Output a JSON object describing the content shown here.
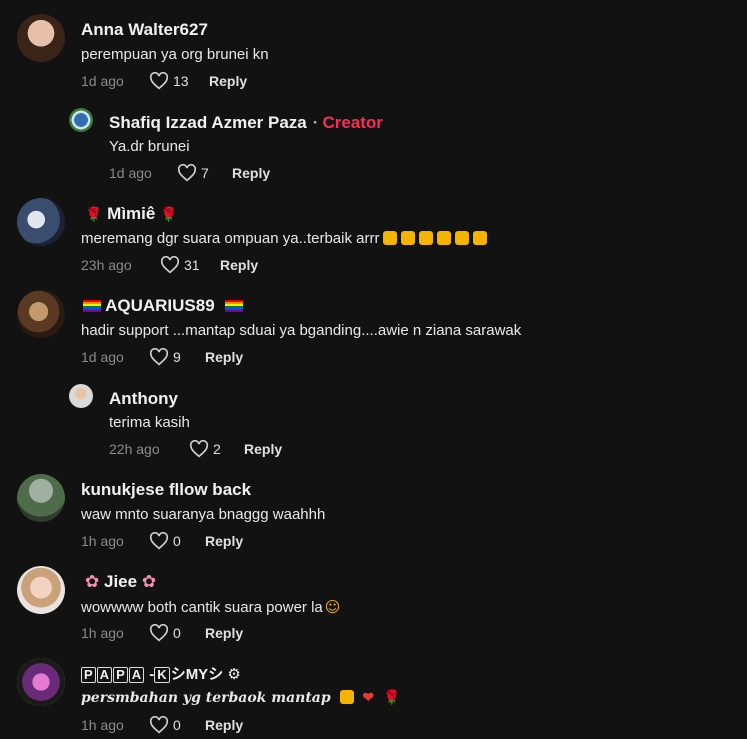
{
  "comments": [
    {
      "name": "Anna Walter627",
      "text": "perempuan ya org brunei kn",
      "time": "1d ago",
      "likes": "13",
      "reply": "Reply"
    },
    {
      "name": "Shafiq Izzad Azmer Paza",
      "badge": "Creator",
      "text": "Ya.dr brunei",
      "time": "1d ago",
      "likes": "7",
      "reply": "Reply"
    },
    {
      "name": "Mìmiê",
      "text": "meremang dgr suara ompuan ya..terbaik arrr",
      "time": "23h ago",
      "likes": "31",
      "reply": "Reply"
    },
    {
      "name": "AQUARIUS89",
      "text": "hadir support ...mantap sduai ya bganding....awie n ziana sarawak",
      "time": "1d ago",
      "likes": "9",
      "reply": "Reply"
    },
    {
      "name": "Anthony",
      "text": "terima kasih",
      "time": "22h ago",
      "likes": "2",
      "reply": "Reply"
    },
    {
      "name": "kunukjese fllow back",
      "text": "waw mnto suaranya bnaggg waahhh",
      "time": "1h ago",
      "likes": "0",
      "reply": "Reply"
    },
    {
      "name": "Jiee",
      "text": "wowwww both cantik suara power la",
      "time": "1h ago",
      "likes": "0",
      "reply": "Reply"
    },
    {
      "name_parts": [
        "P",
        "A",
        "P",
        "A",
        "-",
        "K",
        "シMYシ"
      ],
      "text": "persmbahan yg terbaok mantap",
      "time": "1h ago",
      "likes": "0",
      "reply": "Reply"
    }
  ],
  "colors": {
    "background": "#121212",
    "creator": "#fe2c55",
    "muted": "#8a8a8a"
  }
}
